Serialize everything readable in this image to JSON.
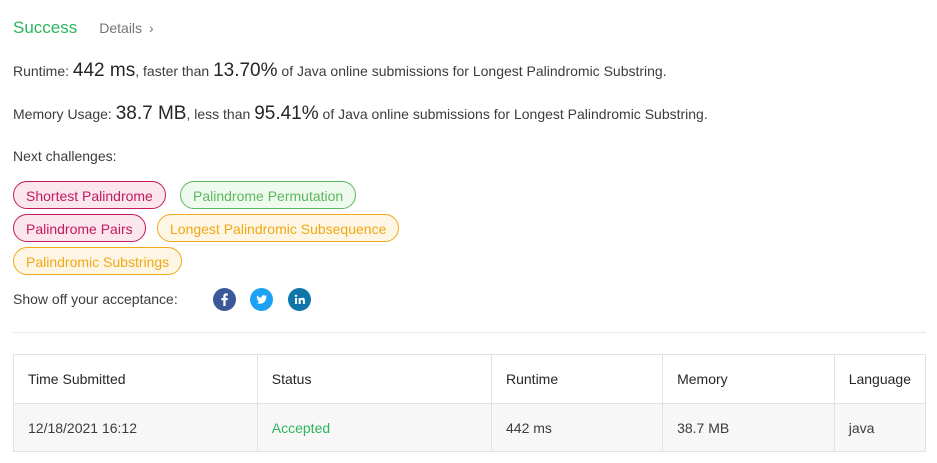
{
  "result": {
    "status": "Success",
    "details_label": "Details",
    "details_chevron": "›"
  },
  "runtime": {
    "label": "Runtime:",
    "value": "442 ms",
    "middle": ", faster than",
    "percent": "13.70%",
    "suffix": "of Java online submissions for Longest Palindromic Substring."
  },
  "memory": {
    "label": "Memory Usage:",
    "value": "38.7 MB",
    "middle": ", less than",
    "percent": "95.41%",
    "suffix": "of Java online submissions for Longest Palindromic Substring."
  },
  "challenges": {
    "label": "Next challenges:",
    "items": [
      {
        "label": "Shortest Palindrome",
        "difficulty": "hard"
      },
      {
        "label": "Palindrome Permutation",
        "difficulty": "easy"
      },
      {
        "label": "Palindrome Pairs",
        "difficulty": "hard"
      },
      {
        "label": "Longest Palindromic Subsequence",
        "difficulty": "medium"
      },
      {
        "label": "Palindromic Substrings",
        "difficulty": "medium"
      }
    ]
  },
  "share": {
    "label": "Show off your acceptance:",
    "icons": [
      {
        "name": "facebook-icon",
        "color": "#3b5998"
      },
      {
        "name": "twitter-icon",
        "color": "#1da1f2"
      },
      {
        "name": "linkedin-icon",
        "color": "#0e76a8"
      }
    ]
  },
  "table": {
    "headers": [
      "Time Submitted",
      "Status",
      "Runtime",
      "Memory",
      "Language"
    ],
    "rows": [
      {
        "time": "12/18/2021 16:12",
        "status": "Accepted",
        "runtime": "442 ms",
        "memory": "38.7 MB",
        "language": "java"
      }
    ]
  },
  "colors": {
    "success": "#2db55d",
    "hard": "#c41a5d",
    "easy": "#5cb85c",
    "medium": "#f0a818"
  }
}
